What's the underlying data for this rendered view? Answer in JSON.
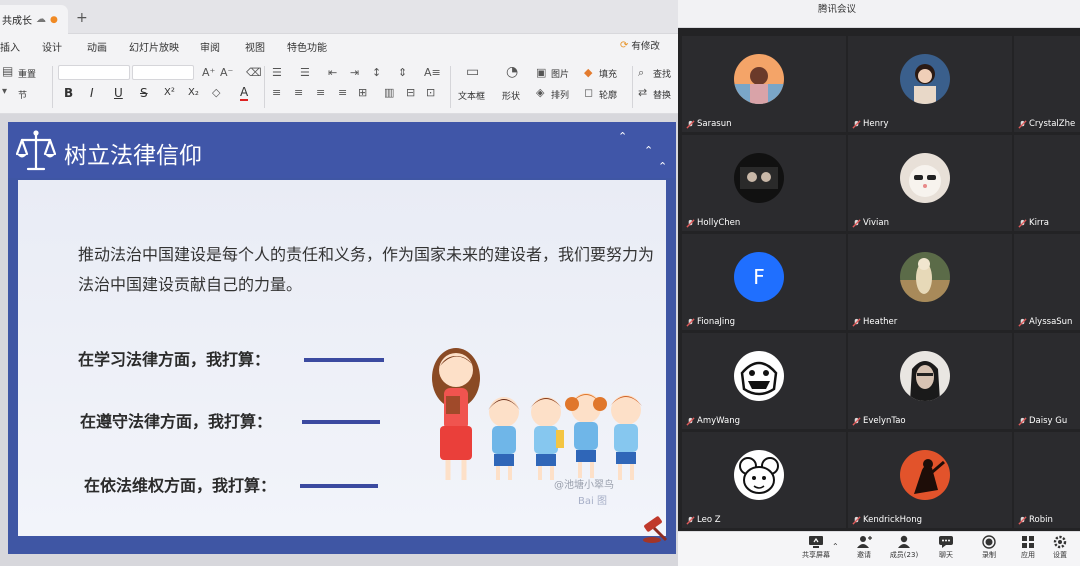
{
  "editor": {
    "doc_tab": "共成长",
    "new_tab": "+",
    "menu": [
      "插入",
      "设计",
      "动画",
      "幻灯片放映",
      "审阅",
      "视图",
      "特色功能"
    ],
    "comment_label": "有修改",
    "toolbar": {
      "reset": "重置",
      "section": "节",
      "bold": "B",
      "italic": "I",
      "underline": "U",
      "strike": "S",
      "superscript": "X²",
      "subscript": "X₂",
      "font_color": "A",
      "text_box": "文本框",
      "shape": "形状",
      "picture": "图片",
      "arrange": "排列",
      "fill": "填充",
      "outline": "轮廓",
      "find": "查找",
      "replace": "替换"
    },
    "slide": {
      "title": "树立法律信仰",
      "paragraph": "推动法治中国建设是每个人的责任和义务，作为国家未来的建设者，我们要努力为法治中国建设贡献自己的力量。",
      "plans": [
        "在学习法律方面，我打算：",
        "在遵守法律方面，我打算：",
        "在依法维权方面，我打算："
      ],
      "watermark": "@池塘小翠鸟",
      "watermark2": "Bai 图"
    }
  },
  "meeting": {
    "title": "腾讯会议",
    "participants": [
      {
        "name": "Sarasun"
      },
      {
        "name": "Henry"
      },
      {
        "name": "CrystalZhe"
      },
      {
        "name": "HollyChen"
      },
      {
        "name": "Vivian"
      },
      {
        "name": "Kirra"
      },
      {
        "name": "FionaJing",
        "initial": "F"
      },
      {
        "name": "Heather"
      },
      {
        "name": "AlyssaSun"
      },
      {
        "name": "AmyWang"
      },
      {
        "name": "EvelynTao"
      },
      {
        "name": "Daisy Gu"
      },
      {
        "name": "Leo Z"
      },
      {
        "name": "KendrickHong"
      },
      {
        "name": "Robin"
      }
    ],
    "bottom_bar": {
      "share": "共享屏幕",
      "invite": "邀请",
      "members": "成员(23)",
      "chat": "聊天",
      "record": "录制",
      "apps": "应用",
      "settings": "设置"
    },
    "colors": {
      "accent": "#1f6fff",
      "tile_bg": "#2b2b2e",
      "mic_red": "#e05a5a"
    }
  }
}
